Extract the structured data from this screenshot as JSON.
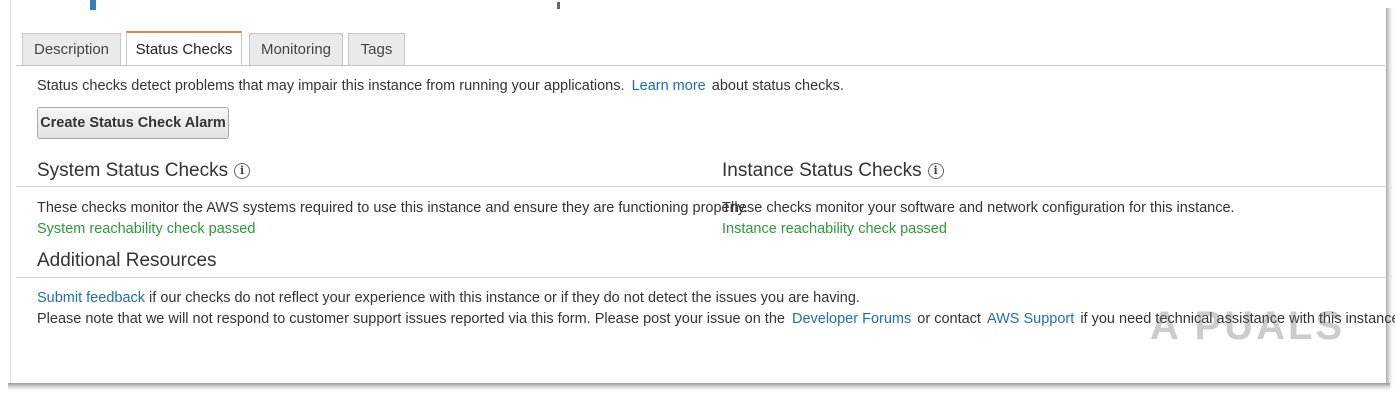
{
  "tabs": [
    "Description",
    "Status Checks",
    "Monitoring",
    "Tags"
  ],
  "intro": {
    "text": "Status checks detect problems that may impair this instance from running your applications.",
    "link": "Learn more",
    "suffix": "about status checks."
  },
  "create_alarm_button": "Create Status Check Alarm",
  "system": {
    "title": "System Status Checks",
    "description": "These checks monitor the AWS systems required to use this instance and ensure they are functioning properly.",
    "status": "System reachability check passed"
  },
  "instance": {
    "title": "Instance Status Checks",
    "description": "These checks monitor your software and network configuration for this instance.",
    "status": "Instance reachability check passed"
  },
  "additional": {
    "title": "Additional Resources",
    "feedback_link": "Submit feedback",
    "feedback_text": "if our checks do not reflect your experience with this instance or if they do not detect the issues you are having.",
    "note_text": "Please note that we will not respond to customer support issues reported via this form. Please post your issue on the",
    "forums_link": "Developer Forums",
    "contact_text": "or contact",
    "support_link": "AWS Support",
    "end_text": "if you need technical assistance with this instance."
  },
  "icons": {
    "info": "info-circle-icon"
  },
  "colors": {
    "link": "#1f6eb5",
    "success": "#2b9a3a",
    "active_tab_accent": "#e38b2c"
  },
  "watermark": "A PUALS"
}
